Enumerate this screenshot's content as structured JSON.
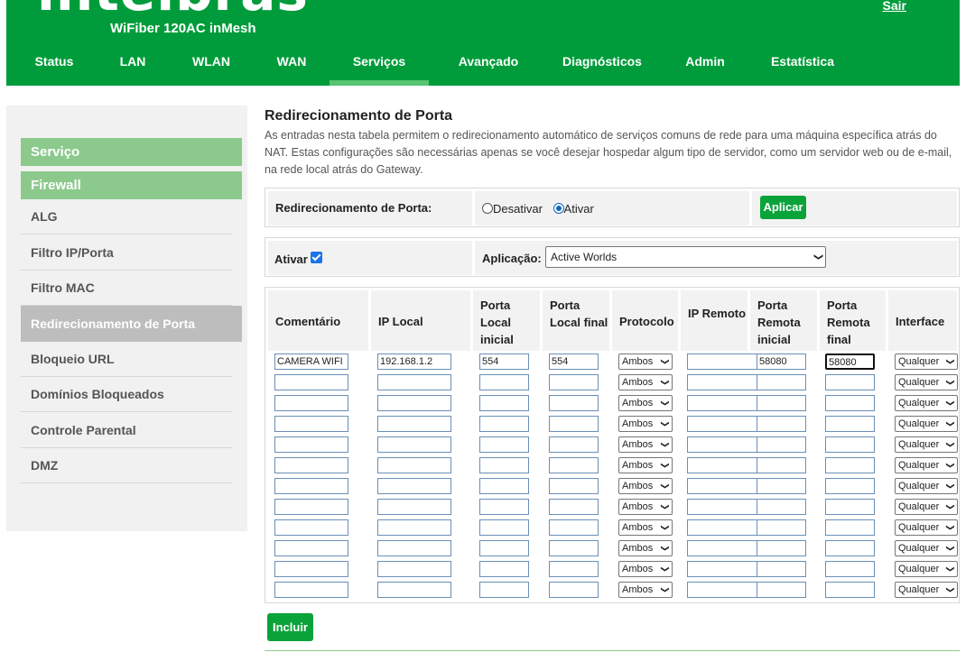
{
  "header": {
    "brand": "intelbras",
    "model": "WiFiber 120AC inMesh",
    "logout": "Sair",
    "nav": [
      "Status",
      "LAN",
      "WLAN",
      "WAN",
      "Serviços",
      "Avançado",
      "Diagnósticos",
      "Admin",
      "Estatística"
    ],
    "active_nav": "Serviços"
  },
  "sidebar": {
    "sections": [
      "Serviço",
      "Firewall"
    ],
    "items": [
      "ALG",
      "Filtro IP/Porta",
      "Filtro MAC",
      "Redirecionamento de Porta",
      "Bloqueio URL",
      "Domínios Bloqueados",
      "Controle Parental",
      "DMZ"
    ],
    "active_item": "Redirecionamento de Porta"
  },
  "main": {
    "title": "Redirecionamento de Porta",
    "description": "As entradas nesta tabela permitem o redirecionamento automático de serviços comuns de rede para uma máquina específica atrás do NAT. Estas configurações são necessárias apenas se você desejar hospedar algum tipo de servidor, como um servidor web ou de e-mail, na rede local atrás do Gateway.",
    "forward_label": "Redirecionamento de Porta:",
    "disable_label": "Desativar",
    "enable_label": "Ativar",
    "apply_button": "Aplicar",
    "activate_label": "Ativar",
    "app_label": "Aplicação:",
    "app_value": "Active Worlds",
    "add_button": "Incluir"
  },
  "table": {
    "headers": {
      "comment": "Comentário",
      "local_ip": "IP Local",
      "local_start": "Porta Local inicial",
      "local_end": "Porta Local final",
      "protocol": "Protocolo",
      "remote_ip": "IP Remoto",
      "remote_start": "Porta Remota inicial",
      "remote_end": "Porta Remota final",
      "interface": "Interface"
    },
    "rows": [
      {
        "comment": "CAMERA WIFI",
        "local_ip": "192.168.1.2",
        "local_start": "554",
        "local_end": "554",
        "protocol": "Ambos",
        "remote_ip": "",
        "remote_start": "58080",
        "remote_end": "58080",
        "interface": "Qualquer"
      },
      {
        "comment": "",
        "local_ip": "",
        "local_start": "",
        "local_end": "",
        "protocol": "Ambos",
        "remote_ip": "",
        "remote_start": "",
        "remote_end": "",
        "interface": "Qualquer"
      },
      {
        "comment": "",
        "local_ip": "",
        "local_start": "",
        "local_end": "",
        "protocol": "Ambos",
        "remote_ip": "",
        "remote_start": "",
        "remote_end": "",
        "interface": "Qualquer"
      },
      {
        "comment": "",
        "local_ip": "",
        "local_start": "",
        "local_end": "",
        "protocol": "Ambos",
        "remote_ip": "",
        "remote_start": "",
        "remote_end": "",
        "interface": "Qualquer"
      },
      {
        "comment": "",
        "local_ip": "",
        "local_start": "",
        "local_end": "",
        "protocol": "Ambos",
        "remote_ip": "",
        "remote_start": "",
        "remote_end": "",
        "interface": "Qualquer"
      },
      {
        "comment": "",
        "local_ip": "",
        "local_start": "",
        "local_end": "",
        "protocol": "Ambos",
        "remote_ip": "",
        "remote_start": "",
        "remote_end": "",
        "interface": "Qualquer"
      },
      {
        "comment": "",
        "local_ip": "",
        "local_start": "",
        "local_end": "",
        "protocol": "Ambos",
        "remote_ip": "",
        "remote_start": "",
        "remote_end": "",
        "interface": "Qualquer"
      },
      {
        "comment": "",
        "local_ip": "",
        "local_start": "",
        "local_end": "",
        "protocol": "Ambos",
        "remote_ip": "",
        "remote_start": "",
        "remote_end": "",
        "interface": "Qualquer"
      },
      {
        "comment": "",
        "local_ip": "",
        "local_start": "",
        "local_end": "",
        "protocol": "Ambos",
        "remote_ip": "",
        "remote_start": "",
        "remote_end": "",
        "interface": "Qualquer"
      },
      {
        "comment": "",
        "local_ip": "",
        "local_start": "",
        "local_end": "",
        "protocol": "Ambos",
        "remote_ip": "",
        "remote_start": "",
        "remote_end": "",
        "interface": "Qualquer"
      },
      {
        "comment": "",
        "local_ip": "",
        "local_start": "",
        "local_end": "",
        "protocol": "Ambos",
        "remote_ip": "",
        "remote_start": "",
        "remote_end": "",
        "interface": "Qualquer"
      },
      {
        "comment": "",
        "local_ip": "",
        "local_start": "",
        "local_end": "",
        "protocol": "Ambos",
        "remote_ip": "",
        "remote_start": "",
        "remote_end": "",
        "interface": "Qualquer"
      }
    ]
  },
  "colors": {
    "brand_green": "#009c3b",
    "section_green": "#8cc98c",
    "button_green": "#0aa33a",
    "active_gray": "#bdbdbd"
  },
  "icons": [
    "chevron-down-icon",
    "checkbox-checked-icon",
    "radio-icon"
  ]
}
